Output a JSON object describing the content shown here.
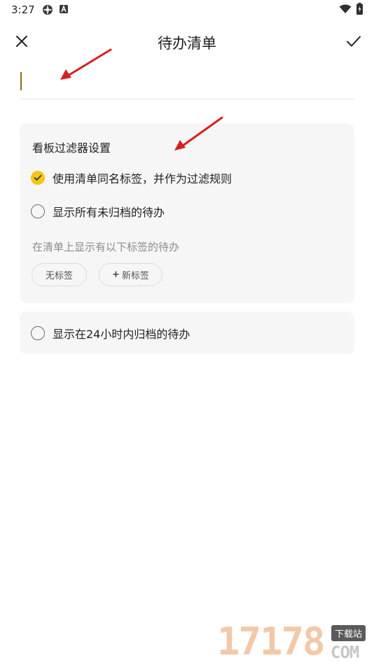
{
  "status_bar": {
    "time": "3:27",
    "icons": [
      "gear-icon",
      "font-a-icon",
      "wifi-icon",
      "battery-icon"
    ]
  },
  "header": {
    "title": "待办清单",
    "close_icon": "close-icon",
    "confirm_icon": "check-icon"
  },
  "name_input": {
    "value": "",
    "placeholder": ""
  },
  "filter_card": {
    "title": "看板过滤器设置",
    "options": [
      {
        "label": "使用清单同名标签，并作为过滤规则",
        "checked": true
      },
      {
        "label": "显示所有未归档的待办",
        "checked": false
      }
    ],
    "hint": "在清单上显示有以下标签的待办",
    "chips": [
      {
        "label": "无标签"
      },
      {
        "label": "新标签",
        "prefix": "+"
      }
    ]
  },
  "archive_card": {
    "option": {
      "label": "显示在24小时内归档的待办",
      "checked": false
    }
  },
  "watermark": {
    "digits": "17178",
    "tag": "下载站",
    "domain": "COM"
  },
  "colors": {
    "accent": "#f5c518",
    "caret": "#8a6d1a",
    "card_bg": "#f6f6f6",
    "annotation_arrow": "#d62020"
  }
}
